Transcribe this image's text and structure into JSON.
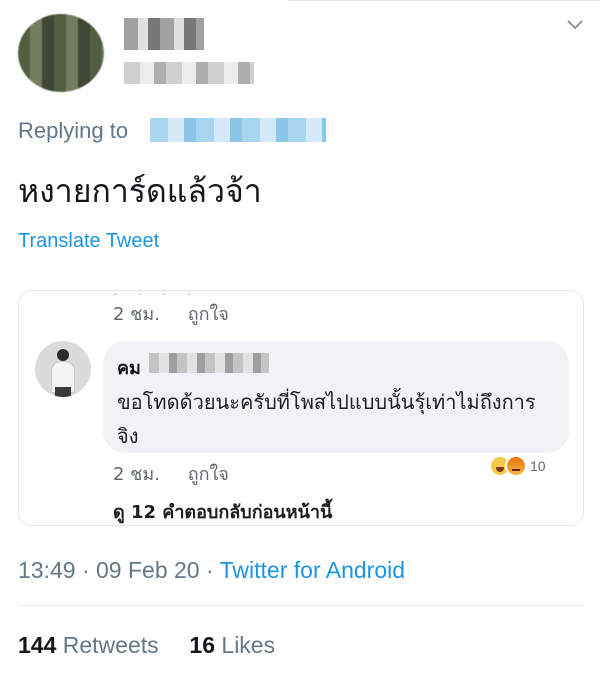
{
  "tweet": {
    "replying_label": "Replying to",
    "text": "หงายการ์ดแล้วจ้า",
    "translate_label": "Translate Tweet",
    "time": "13:49",
    "date": "09 Feb 20",
    "separator": "·",
    "client": "Twitter for Android",
    "retweets_count": "144",
    "retweets_label": "Retweets",
    "likes_count": "16",
    "likes_label": "Likes",
    "menu_icon": "chevron-down-icon"
  },
  "embedded_comment": {
    "top_time": "2 ชม.",
    "top_like": "ถูกใจ",
    "commenter_prefix": "คม",
    "text": "ขอโทดด้วยนะครับที่โพสไปแบบนั้นรุ้เท่าไม่ถึงการจิง",
    "time": "2 ชม.",
    "like": "ถูกใจ",
    "reaction_count": "10",
    "view_replies": "ดู 12 คำตอบกลับก่อนหน้านี้",
    "reaction_icons": [
      "haha-icon",
      "angry-icon"
    ]
  },
  "colors": {
    "link": "#1b95e0",
    "muted": "#657786",
    "text": "#14171a"
  }
}
